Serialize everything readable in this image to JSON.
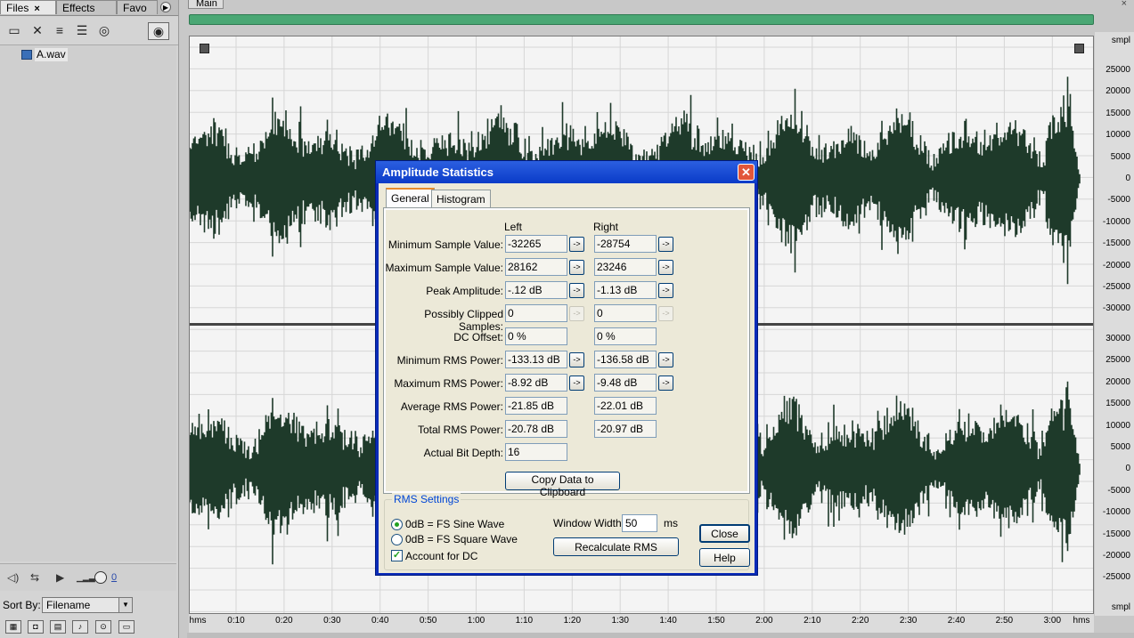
{
  "left_panel": {
    "tabs": [
      {
        "label": "Files",
        "close": "×"
      },
      {
        "label": "Effects"
      },
      {
        "label": "Favo"
      }
    ],
    "tab_scroll_icon": "play-right-icon",
    "toolbar_icons": [
      "open-file-icon",
      "close-file-icon",
      "insert-multitrack-icon",
      "insert-cd-icon",
      "autoplay-icon",
      "show-preview-icon"
    ],
    "files": [
      {
        "name": "A.wav",
        "icon": "waveform-file-icon"
      }
    ],
    "preview_controls": {
      "volume_value": "0"
    },
    "sort": {
      "label": "Sort By:",
      "value": "Filename"
    },
    "view_button_icons": [
      "audio-files-icon",
      "loop-icon",
      "video-icon",
      "midi-icon",
      "show-icon",
      "full-path-icon"
    ]
  },
  "main": {
    "tab_label": "Main",
    "close_glyph": "×",
    "amplitude_unit_top": "smpl",
    "amplitude_unit_bottom": "smpl",
    "amplitude_labels_top": [
      "25000",
      "20000",
      "15000",
      "10000",
      "5000",
      "0",
      "-5000",
      "-10000",
      "-15000",
      "-20000",
      "-25000",
      "-30000"
    ],
    "amplitude_labels_bottom": [
      "30000",
      "25000",
      "20000",
      "15000",
      "10000",
      "5000",
      "0",
      "-5000",
      "-10000",
      "-15000",
      "-20000",
      "-25000"
    ],
    "time_labels": [
      "hms",
      "0:10",
      "0:20",
      "0:30",
      "0:40",
      "0:50",
      "1:00",
      "1:10",
      "1:20",
      "1:30",
      "1:40",
      "1:50",
      "2:00",
      "2:10",
      "2:20",
      "2:30",
      "2:40",
      "2:50",
      "3:00",
      "hms"
    ]
  },
  "dialog": {
    "title": "Amplitude Statistics",
    "close_glyph": "✕",
    "tabs": [
      "General",
      "Histogram"
    ],
    "columns": {
      "left": "Left",
      "right": "Right"
    },
    "arrow_glyph": "->",
    "rows": [
      {
        "label": "Minimum Sample Value:",
        "left": "-32265",
        "right": "-28754"
      },
      {
        "label": "Maximum Sample Value:",
        "left": "28162",
        "right": "23246"
      },
      {
        "label": "Peak Amplitude:",
        "left": "-.12 dB",
        "right": "-1.13 dB"
      },
      {
        "label": "Possibly Clipped Samples:",
        "left": "0",
        "right": "0"
      },
      {
        "label": "DC Offset:",
        "left": "0 %",
        "right": "0 %"
      },
      {
        "label": "Minimum RMS Power:",
        "left": "-133.13 dB",
        "right": "-136.58 dB"
      },
      {
        "label": "Maximum RMS Power:",
        "left": "-8.92 dB",
        "right": "-9.48 dB"
      },
      {
        "label": "Average RMS Power:",
        "left": "-21.85 dB",
        "right": "-22.01 dB"
      },
      {
        "label": "Total RMS Power:",
        "left": "-20.78 dB",
        "right": "-20.97 dB"
      },
      {
        "label": "Actual Bit Depth:",
        "left": "16"
      }
    ],
    "copy_button": "Copy Data to Clipboard",
    "rms_settings": {
      "legend": "RMS Settings",
      "sine_label": "0dB = FS Sine Wave",
      "square_label": "0dB = FS Square Wave",
      "dc_label": "Account for DC",
      "window_width_label": "Window Width:",
      "window_width_value": "50",
      "window_width_unit": "ms",
      "recalculate_button": "Recalculate RMS"
    },
    "close_button": "Close",
    "help_button": "Help"
  },
  "colors": {
    "waveform": "#1e3a2a",
    "overview": "#4aa774",
    "title_bar": "#0a3bc8"
  }
}
